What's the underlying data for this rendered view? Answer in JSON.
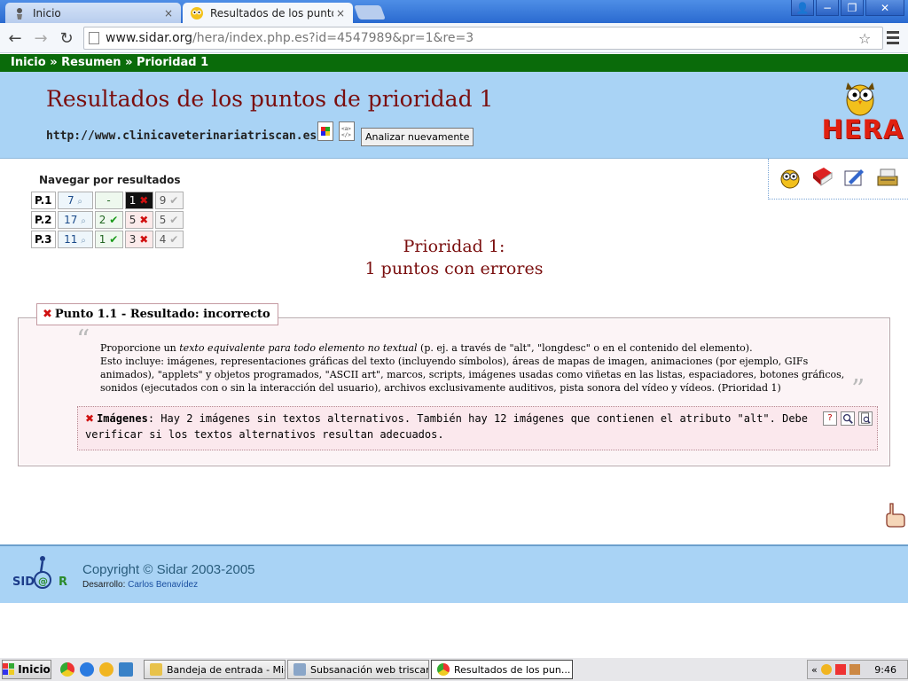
{
  "browser": {
    "tabs": [
      {
        "title": "Inicio",
        "active": false
      },
      {
        "title": "Resultados de los puntos de",
        "active": true
      }
    ],
    "address": {
      "host": "www.sidar.org",
      "path": "/hera/index.php.es?id=4547989&pr=1&re=3"
    },
    "close_glyph": "×",
    "window_buttons": {
      "user": "👤",
      "minimize": "−",
      "restore": "❐",
      "close": "✕"
    },
    "nav": {
      "back": "←",
      "forward": "→",
      "reload": "↻",
      "star": "☆"
    }
  },
  "page": {
    "breadcrumb": [
      "Inicio",
      "Resumen",
      "Prioridad 1"
    ],
    "breadcrumb_separator": "»",
    "title": "Resultados de los puntos de prioridad 1",
    "analyzed_url": "http://www.clinicaveterinariatriscan.es/",
    "reanalyze_label": "Analizar nuevamente",
    "logo_text": "HERA",
    "results_nav": {
      "title": "Navegar por resultados",
      "rows": [
        {
          "label": "P.1",
          "check": "7",
          "ok": "-",
          "fail": "1",
          "na": "9"
        },
        {
          "label": "P.2",
          "check": "17",
          "ok": "2",
          "fail": "5",
          "na": "5"
        },
        {
          "label": "P.3",
          "check": "11",
          "ok": "1",
          "fail": "3",
          "na": "4"
        }
      ],
      "marks": {
        "check": "⌕",
        "ok": "✔",
        "fail": "✖",
        "na": "✔"
      }
    },
    "summary": {
      "line1": "Prioridad 1:",
      "line2": "1 puntos con errores"
    },
    "checkpoint": {
      "heading": "Punto 1.1 - Resultado: incorrecto",
      "mark": "✖",
      "quote_open": "“",
      "quote_close": "”",
      "desc_pre": "Proporcione un ",
      "desc_em": "texto equivalente para todo elemento no textual",
      "desc_post": " (p. ej. a través de \"alt\", \"longdesc\" o en el contenido del elemento).",
      "desc_line2": "Esto incluye: imágenes, representaciones gráficas del texto (incluyendo símbolos), áreas de mapas de imagen, animaciones (por ejemplo, GIFs animados), \"applets\" y objetos programados, \"ASCII art\", marcos, scripts, imágenes usadas como viñetas en las listas, espaciadores, botones gráficos, sonidos (ejecutados con o sin la interacción del usuario), archivos exclusivamente auditivos, pista sonora del vídeo y vídeos. (Prioridad 1)",
      "issue_label": "Imágenes",
      "issue_text": ": Hay 2 imágenes sin textos alternativos. También hay 12 imágenes que contienen el atributo \"alt\". Debe verificar si los textos alternativos resultan adecuados.",
      "issue_icon_help": "?"
    },
    "footer": {
      "logo_text": "SIDAR",
      "copyright": "Copyright © Sidar 2003-2005",
      "dev_label": "Desarrollo: ",
      "dev_name": "Carlos Benavídez"
    }
  },
  "taskbar": {
    "start_label": "Inicio",
    "tasks": [
      {
        "title": "Bandeja de entrada - Mic...",
        "active": false
      },
      {
        "title": "Subsanación web triscan....",
        "active": false
      },
      {
        "title": "Resultados de los pun...",
        "active": true
      }
    ],
    "tray_arrow": "«",
    "clock": "9:46"
  },
  "colors": {
    "header_bg": "#a9d3f5",
    "breadcrumb_bg": "#0a6b0a",
    "title_color": "#7a0e0e",
    "error_red": "#d01010"
  }
}
